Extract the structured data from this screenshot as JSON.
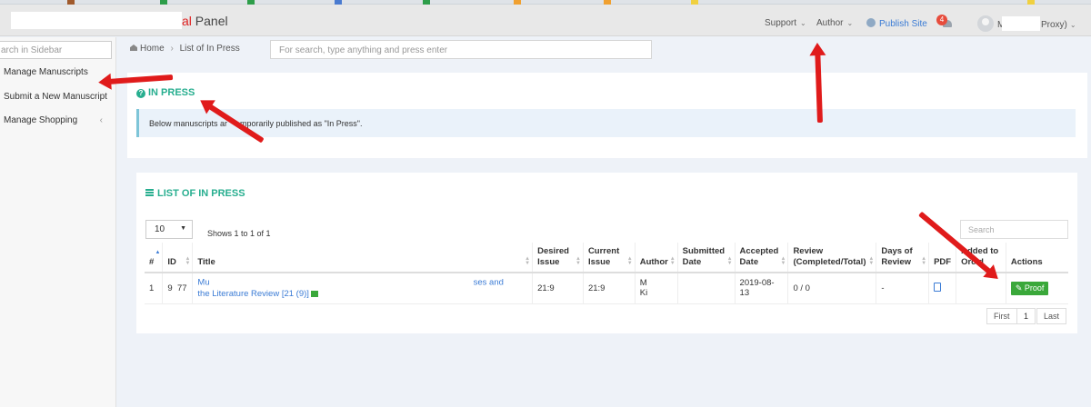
{
  "header": {
    "title_partial": "al",
    "title_panel": "Panel",
    "support": "Support",
    "author": "Author",
    "publish_site": "Publish Site",
    "notifications_count": "4",
    "user_initial": "M",
    "user_suffix": "Proxy)"
  },
  "sidebar": {
    "search_placeholder": "arch in Sidebar",
    "items": [
      {
        "label": "Manage Manuscripts"
      },
      {
        "label": "Submit a New Manuscript"
      },
      {
        "label": "Manage Shopping"
      }
    ]
  },
  "breadcrumb": {
    "home": "Home",
    "separator": "›",
    "current": "List of In Press"
  },
  "global_search": {
    "placeholder": "For search, type anything and press enter"
  },
  "in_press": {
    "title": "IN PRESS",
    "info_prefix": "Below manuscripts ar",
    "info_suffix": "mporarily published as \"In Press\"."
  },
  "list": {
    "title": "LIST OF IN PRESS",
    "page_length": "10",
    "shows": "Shows 1 to 1 of 1",
    "search_placeholder": "Search",
    "columns": [
      "#",
      "ID",
      "Title",
      "Desired Issue",
      "Current Issue",
      "Author",
      "Submitted Date",
      "Accepted Date",
      "Review (Completed/Total)",
      "Days of Review",
      "PDF",
      "Added to Orcid",
      "Actions"
    ],
    "rows": [
      {
        "num": "1",
        "id_a": "9",
        "id_b": "77",
        "title_start": "Mu",
        "title_end": "ses and",
        "title_line2": "the Literature Review [21 (9)]",
        "desired_issue": "21:9",
        "current_issue": "21:9",
        "author_a": "M",
        "author_b": "Ki",
        "submitted": "",
        "accepted": "2019-08-13",
        "review": "0 / 0",
        "days": "-",
        "action": "Proof"
      }
    ],
    "pager": {
      "first": "First",
      "page": "1",
      "last": "Last"
    }
  },
  "colors": {
    "accent": "#27ae8f",
    "link": "#3a7bd5",
    "annotation": "#e01b1b",
    "proof_button": "#3aa83a"
  }
}
